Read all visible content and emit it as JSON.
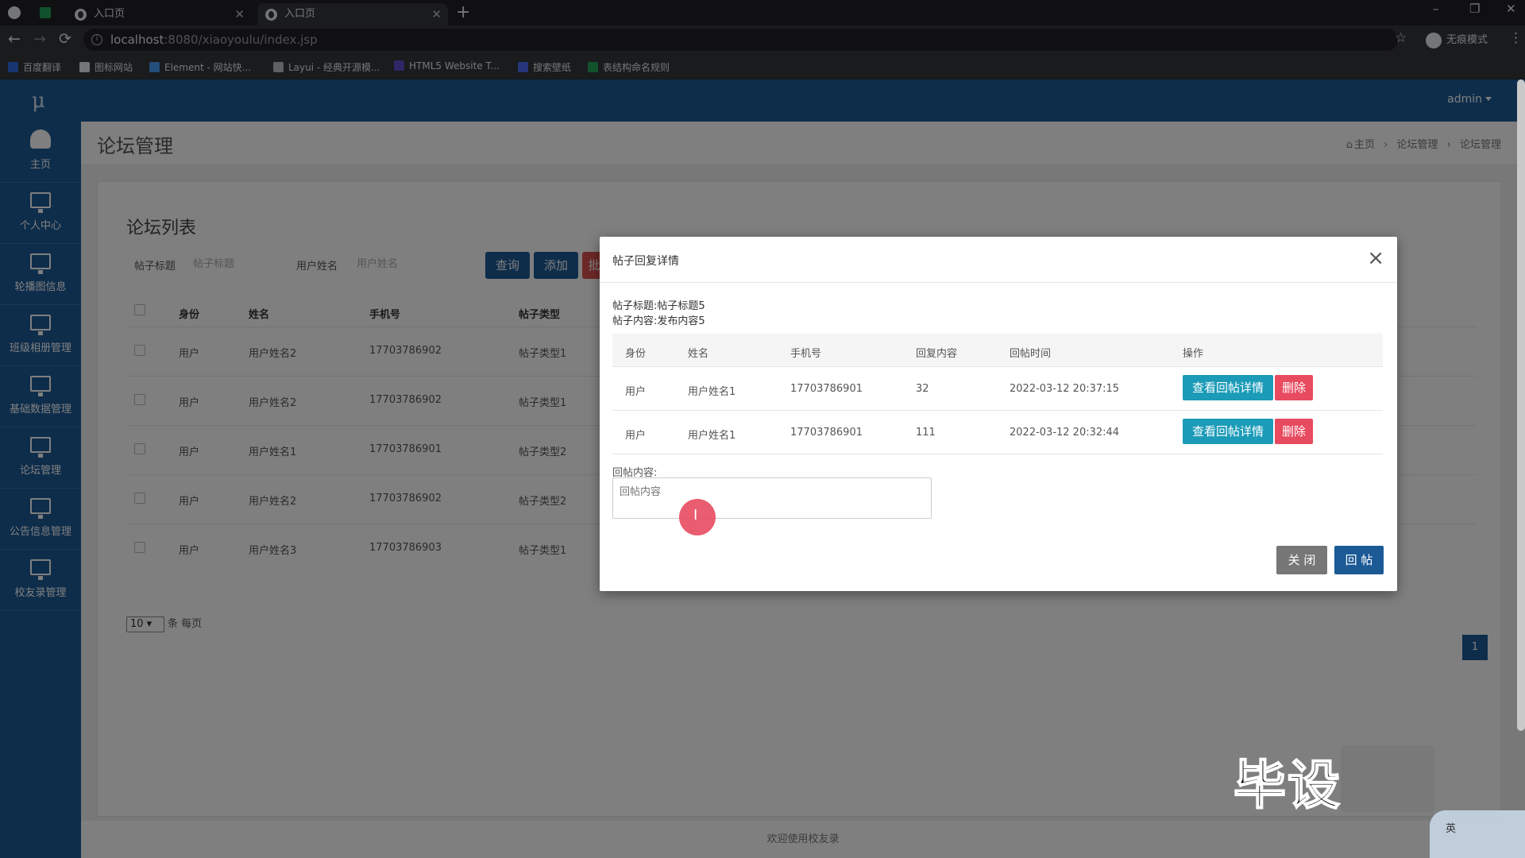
{
  "browser": {
    "tabs": [
      {
        "label": "入口页"
      },
      {
        "label": "入口页"
      }
    ],
    "url_host": "localhost",
    "url_path": ":8080/xiaoyoulu/index.jsp",
    "incognito_label": "无痕模式",
    "bookmarks": [
      {
        "label": "百度翻译",
        "color": "#2f6be0"
      },
      {
        "label": "图标网站",
        "color": "#e8eaed"
      },
      {
        "label": "Element - 网站快...",
        "color": "#4a9ff5"
      },
      {
        "label": "Layui - 经典开源模...",
        "color": "#bdc1c6"
      },
      {
        "label": "HTML5 Website T...",
        "color": "#5a4fcf"
      },
      {
        "label": "搜索壁纸",
        "color": "#4a6cf7"
      },
      {
        "label": "表结构命名规则",
        "color": "#22a559"
      }
    ]
  },
  "app": {
    "logo": "μ",
    "user": "admin",
    "sidebar": [
      {
        "label": "主页",
        "icon": "dashboard-icon"
      },
      {
        "label": "个人中心",
        "icon": "monitor-icon"
      },
      {
        "label": "轮播图信息",
        "icon": "monitor-icon"
      },
      {
        "label": "班级相册管理",
        "icon": "monitor-icon"
      },
      {
        "label": "基础数据管理",
        "icon": "monitor-icon"
      },
      {
        "label": "论坛管理",
        "icon": "monitor-icon"
      },
      {
        "label": "公告信息管理",
        "icon": "monitor-icon"
      },
      {
        "label": "校友录管理",
        "icon": "monitor-icon"
      }
    ],
    "page_title": "论坛管理",
    "breadcrumb": [
      "主页",
      "论坛管理",
      "论坛管理"
    ],
    "panel_title": "论坛列表",
    "search": {
      "title_label": "帖子标题",
      "title_placeholder": "帖子标题",
      "name_label": "用户姓名",
      "name_placeholder": "用户姓名",
      "query_btn": "查询",
      "add_btn": "添加",
      "red_btn": "批"
    },
    "table": {
      "headers": [
        "身份",
        "姓名",
        "手机号",
        "帖子类型"
      ],
      "rows": [
        [
          "用户",
          "用户姓名2",
          "17703786902",
          "帖子类型1"
        ],
        [
          "用户",
          "用户姓名2",
          "17703786902",
          "帖子类型1"
        ],
        [
          "用户",
          "用户姓名1",
          "17703786901",
          "帖子类型2"
        ],
        [
          "用户",
          "用户姓名2",
          "17703786902",
          "帖子类型2"
        ],
        [
          "用户",
          "用户姓名3",
          "17703786903",
          "帖子类型1"
        ]
      ]
    },
    "per_page_value": "10",
    "per_page_label": "条 每页",
    "page_number": "1",
    "footer": "欢迎使用校友录"
  },
  "modal": {
    "title": "帖子回复详情",
    "post_title_line": "帖子标题:帖子标题5",
    "post_content_line": "帖子内容:发布内容5",
    "headers": [
      "身份",
      "姓名",
      "手机号",
      "回复内容",
      "回帖时间",
      "操作"
    ],
    "rows": [
      [
        "用户",
        "用户姓名1",
        "17703786901",
        "32",
        "2022-03-12 20:37:15"
      ],
      [
        "用户",
        "用户姓名1",
        "17703786901",
        "111",
        "2022-03-12 20:32:44"
      ]
    ],
    "detail_btn": "查看回帖详情",
    "delete_btn": "删除",
    "reply_label": "回帖内容:",
    "reply_placeholder": "回帖内容",
    "close_btn": "关 闭",
    "reply_btn": "回 帖"
  },
  "watermark": "毕设",
  "ime_label": "英"
}
